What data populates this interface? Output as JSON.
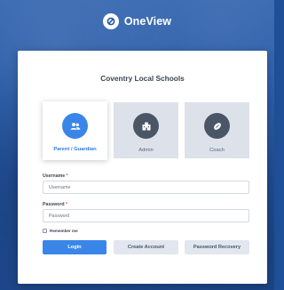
{
  "brand": {
    "name": "OneView",
    "logo_icon": "oneview-logo-icon"
  },
  "school": {
    "name": "Coventry Local Schools"
  },
  "roles": [
    {
      "label": "Parent / Guardian",
      "icon": "people-icon",
      "selected": true
    },
    {
      "label": "Admin",
      "icon": "building-icon",
      "selected": false
    },
    {
      "label": "Coach",
      "icon": "ball-icon",
      "selected": false
    }
  ],
  "form": {
    "username_label": "Username",
    "username_placeholder": "Username",
    "password_label": "Password",
    "password_placeholder": "Password",
    "required_mark": "*",
    "remember_label": "Remember me"
  },
  "buttons": {
    "login": "Login",
    "create_account": "Create Account",
    "password_recovery": "Password Recovery"
  },
  "colors": {
    "accent": "#3a86e8",
    "background": "#2558a5",
    "role_bg": "#dde1ea",
    "icon_dark": "#4a5666"
  }
}
